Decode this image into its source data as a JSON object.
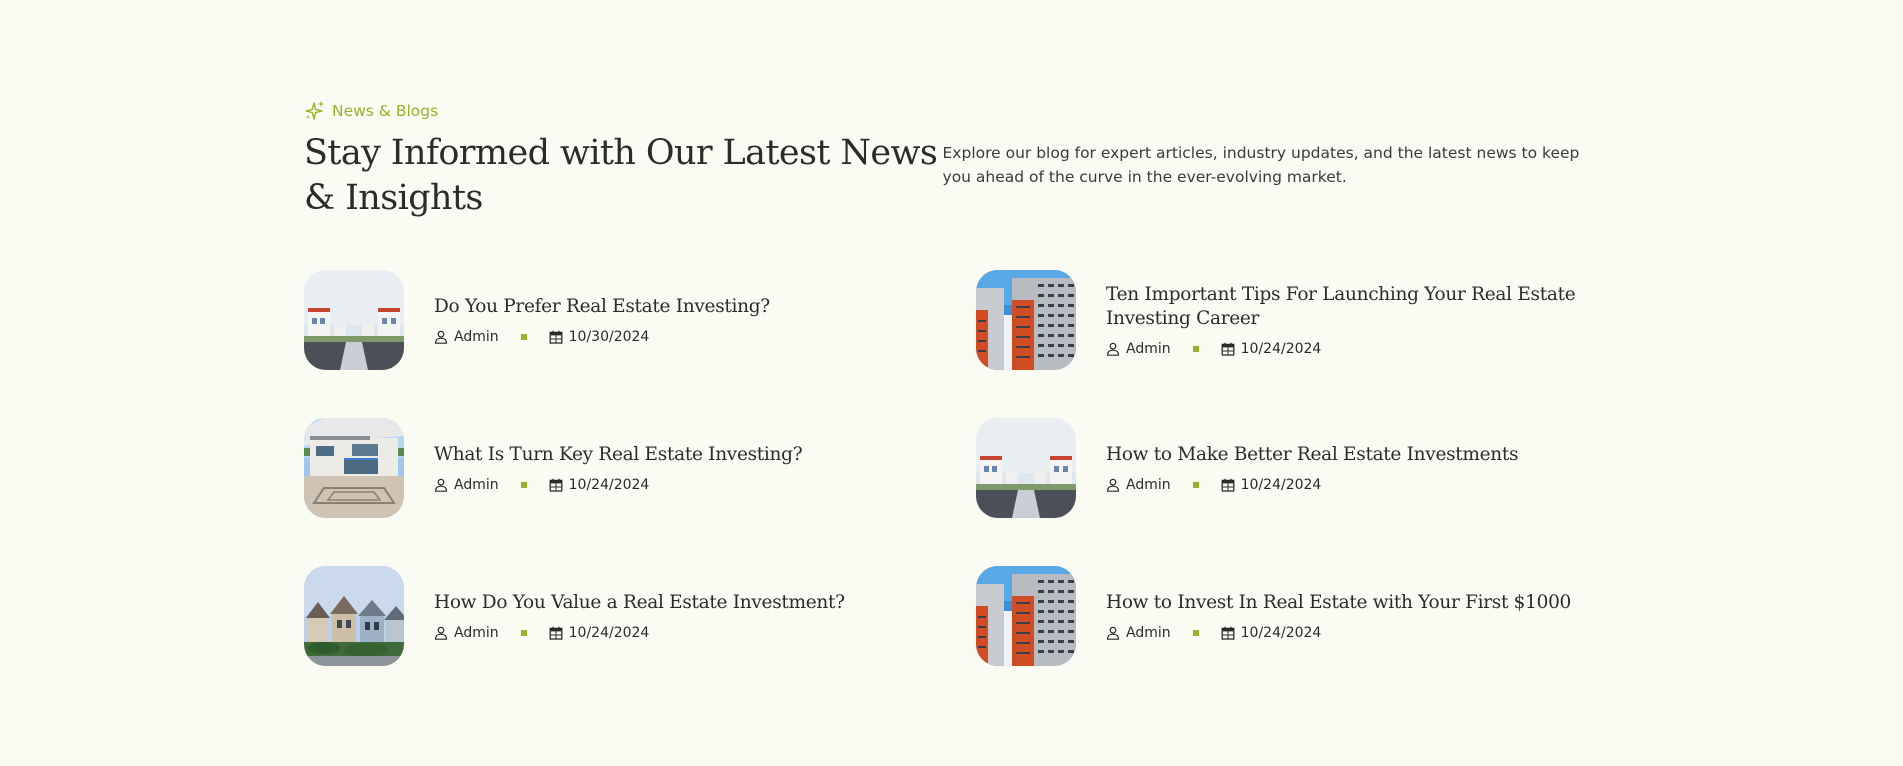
{
  "section": {
    "eyebrow": "News & Blogs",
    "eyebrow_icon": "sparkle-icon",
    "title": "Stay Informed with Our Latest News & Insights",
    "intro": "Explore our blog for expert articles, industry updates, and the latest news to keep you ahead of the curve in the ever-evolving market."
  },
  "colors": {
    "background": "#fafbf3",
    "accent": "#9bb026",
    "text": "#2b2b2b"
  },
  "posts": [
    {
      "title": "Do You Prefer Real Estate Investing?",
      "author": "Admin",
      "date": "10/30/2024",
      "image": "street-houses"
    },
    {
      "title": "Ten Important Tips For Launching Your Real Estate Investing Career",
      "author": "Admin",
      "date": "10/24/2024",
      "image": "apartment-towers"
    },
    {
      "title": "What Is Turn Key Real Estate Investing?",
      "author": "Admin",
      "date": "10/24/2024",
      "image": "modern-house"
    },
    {
      "title": "How to Make Better Real Estate Investments",
      "author": "Admin",
      "date": "10/24/2024",
      "image": "street-houses"
    },
    {
      "title": "How Do You Value a Real Estate Investment?",
      "author": "Admin",
      "date": "10/24/2024",
      "image": "victorian-houses"
    },
    {
      "title": "How to Invest In Real Estate with Your First $1000",
      "author": "Admin",
      "date": "10/24/2024",
      "image": "apartment-towers"
    }
  ]
}
